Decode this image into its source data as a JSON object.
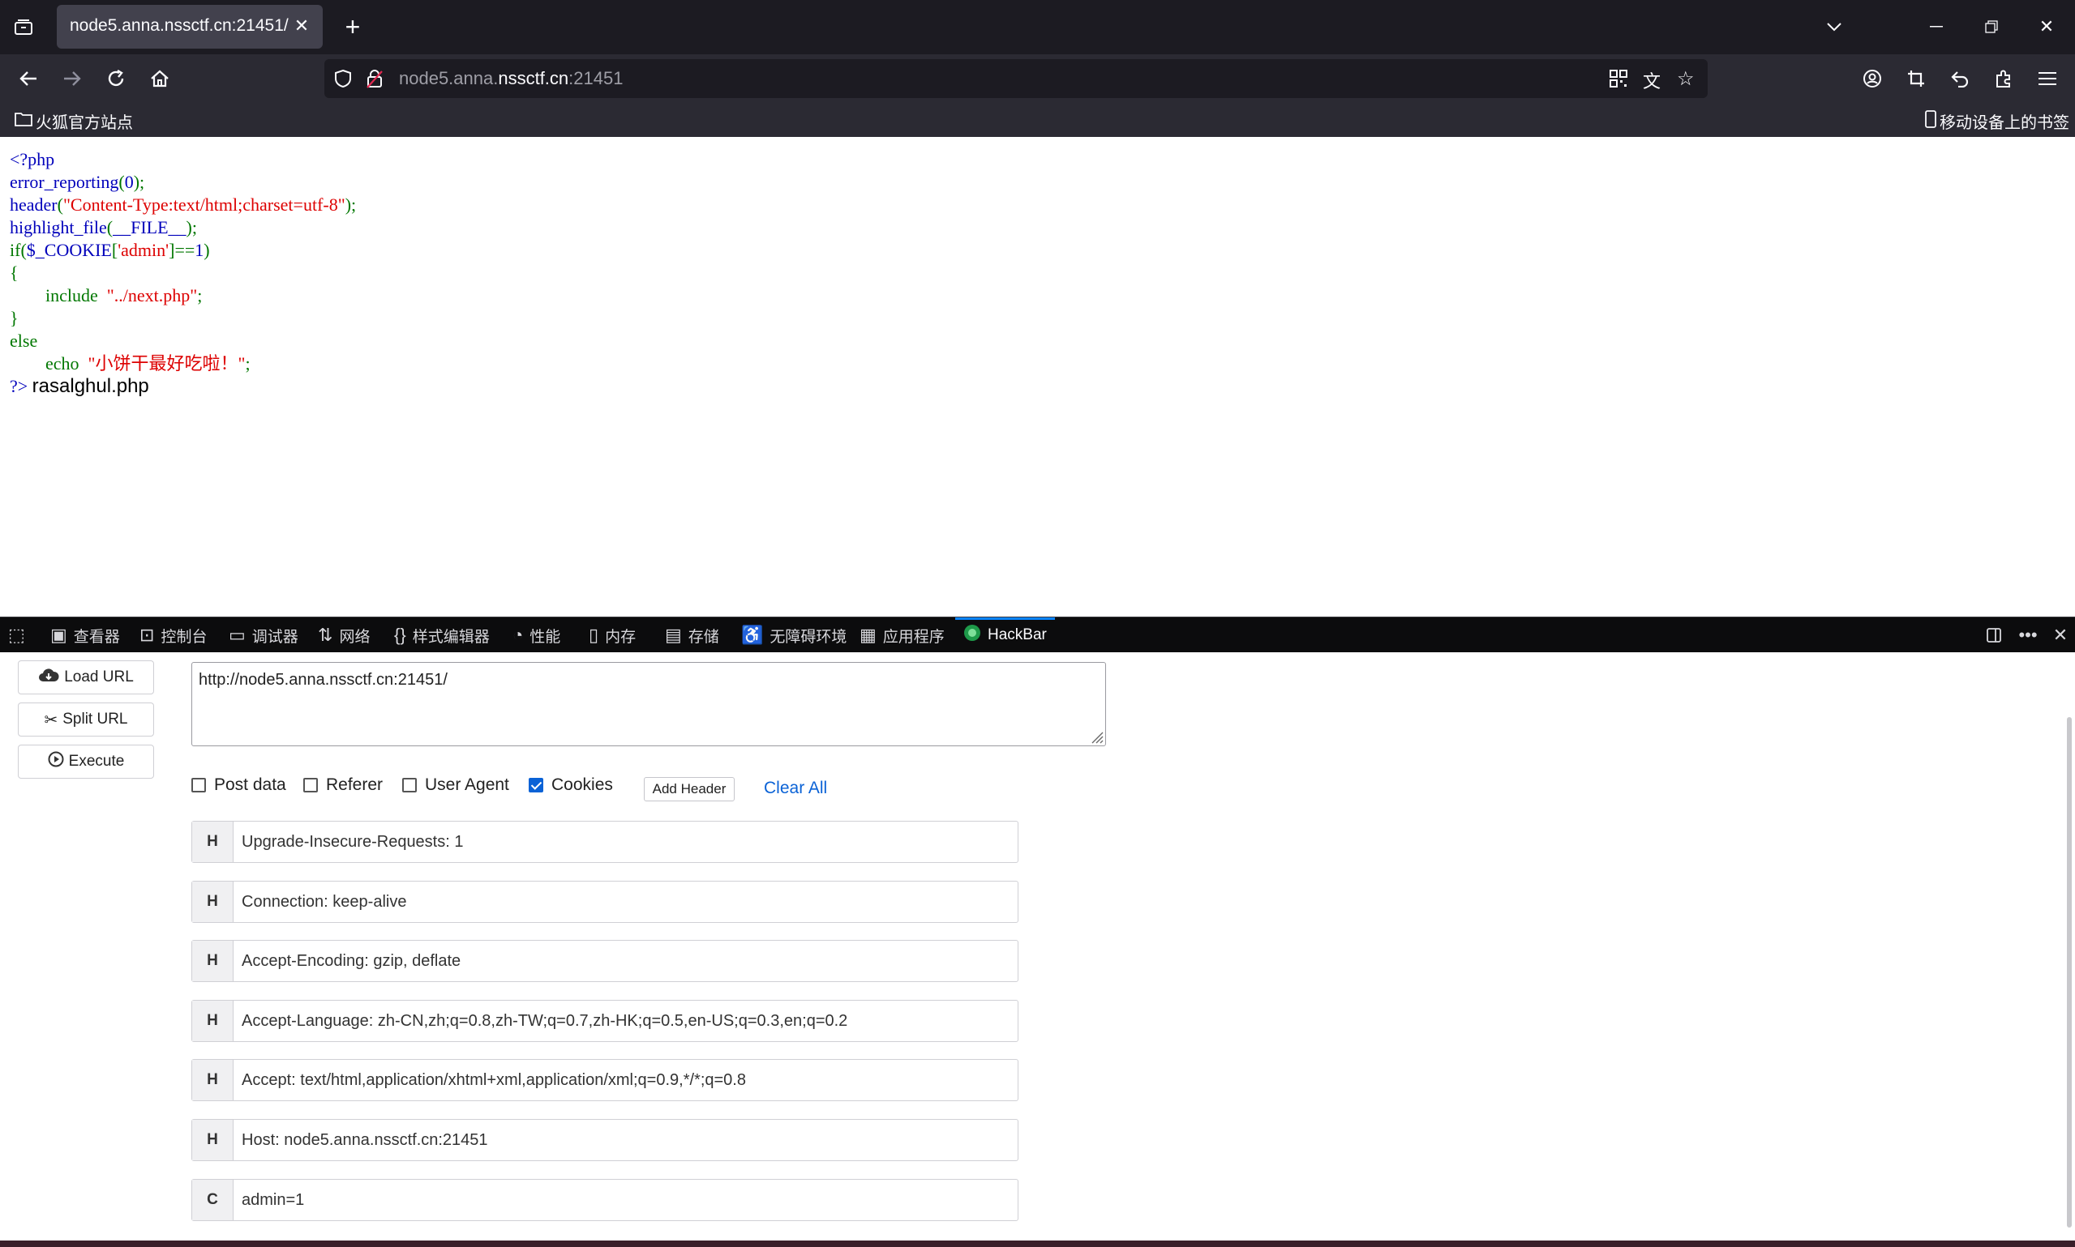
{
  "tab": {
    "title": "node5.anna.nssctf.cn:21451/"
  },
  "navbar": {
    "url_host_dim": "node5.anna.",
    "url_host_main": "nssctf.cn",
    "url_port": ":21451"
  },
  "bookmarks": {
    "left": "火狐官方站点",
    "right": "移动设备上的书签"
  },
  "code": {
    "l1": "<?php",
    "l2a": "error_reporting",
    "l2b": "(",
    "l2c": "0",
    "l2d": ");",
    "l3a": "header",
    "l3b": "(",
    "l3c": "\"Content-Type:text/html;charset=utf-8\"",
    "l3d": ");",
    "l4a": "highlight_file",
    "l4b": "(",
    "l4c": "__FILE__",
    "l4d": ");",
    "l5a": "if(",
    "l5b": "$_COOKIE",
    "l5c": "[",
    "l5d": "'admin'",
    "l5e": "]==",
    "l5f": "1",
    "l5g": ")",
    "l6": "{",
    "l7a": "include",
    "l7b": "\"../next.php\"",
    "l7c": ";",
    "l8": "}",
    "l9": "else",
    "l10a": "echo",
    "l10b": "\"小饼干最好吃啦！\"",
    "l10c": ";",
    "l11a": "?>",
    "l11b": "rasalghul.php"
  },
  "devtools": {
    "tabs": [
      "查看器",
      "控制台",
      "调试器",
      "网络",
      "样式编辑器",
      "性能",
      "内存",
      "存储",
      "无障碍环境",
      "应用程序",
      "HackBar"
    ]
  },
  "hackbar": {
    "load_url": "Load URL",
    "split_url": "Split URL",
    "execute": "Execute",
    "url_value": "http://node5.anna.nssctf.cn:21451/",
    "post_data": "Post data",
    "referer": "Referer",
    "user_agent": "User Agent",
    "cookies": "Cookies",
    "add_header": "Add Header",
    "clear_all": "Clear All",
    "headers": [
      {
        "tag": "H",
        "value": "Upgrade-Insecure-Requests: 1"
      },
      {
        "tag": "H",
        "value": "Connection: keep-alive"
      },
      {
        "tag": "H",
        "value": "Accept-Encoding: gzip, deflate"
      },
      {
        "tag": "H",
        "value": "Accept-Language: zh-CN,zh;q=0.8,zh-TW;q=0.7,zh-HK;q=0.5,en-US;q=0.3,en;q=0.2"
      },
      {
        "tag": "H",
        "value": "Accept: text/html,application/xhtml+xml,application/xml;q=0.9,*/*;q=0.8"
      },
      {
        "tag": "H",
        "value": "Host: node5.anna.nssctf.cn:21451"
      },
      {
        "tag": "C",
        "value": "admin=1"
      }
    ],
    "checkbox_state": {
      "post_data": false,
      "referer": false,
      "user_agent": false,
      "cookies": true
    }
  },
  "colors": {
    "accent": "#0a84ff",
    "php_default": "#0000BB",
    "php_keyword": "#007700",
    "php_string": "#DD0000"
  }
}
